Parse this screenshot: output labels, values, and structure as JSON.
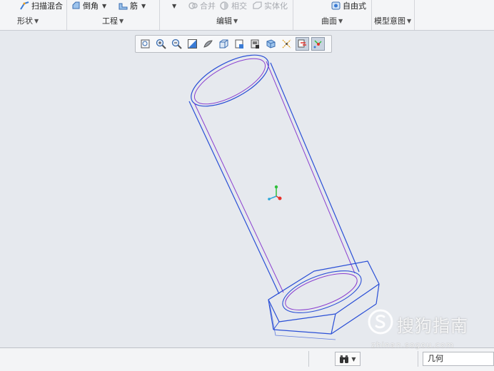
{
  "ribbon": {
    "buttons": {
      "sweep_blend": "扫描混合",
      "chamfer": "倒角",
      "rib": "筋",
      "merge": "合并",
      "intersect": "相交",
      "solidify": "实体化",
      "freestyle": "自由式"
    },
    "groups": {
      "shape": "形状",
      "engineering": "工程",
      "editing": "编辑",
      "surfaces": "曲面",
      "model_intent": "模型意图"
    },
    "dropdown_caret": "▼"
  },
  "view_toolbar": {
    "icons": [
      "refit-icon",
      "zoom-in-icon",
      "zoom-out-icon",
      "repaint-icon",
      "display-style-icon",
      "saved-orientations-icon",
      "view-manager-icon",
      "perspective-icon",
      "section-icon",
      "datum-display-icon",
      "spin-center-icon",
      "annotation-display-icon"
    ],
    "active": [
      "spin-center-icon",
      "annotation-display-icon"
    ]
  },
  "status_bar": {
    "filter_value": "几何"
  },
  "watermark": {
    "text": "搜狗指南",
    "url": "zhinan.sogou.com"
  },
  "colors": {
    "model_edge": "#2a4fd6",
    "model_inner": "#8a3fd0",
    "axis_x": "#e8312a",
    "axis_y": "#2fbf3a",
    "axis_z": "#2aa6d8",
    "canvas_bg": "#e6e9ee"
  }
}
